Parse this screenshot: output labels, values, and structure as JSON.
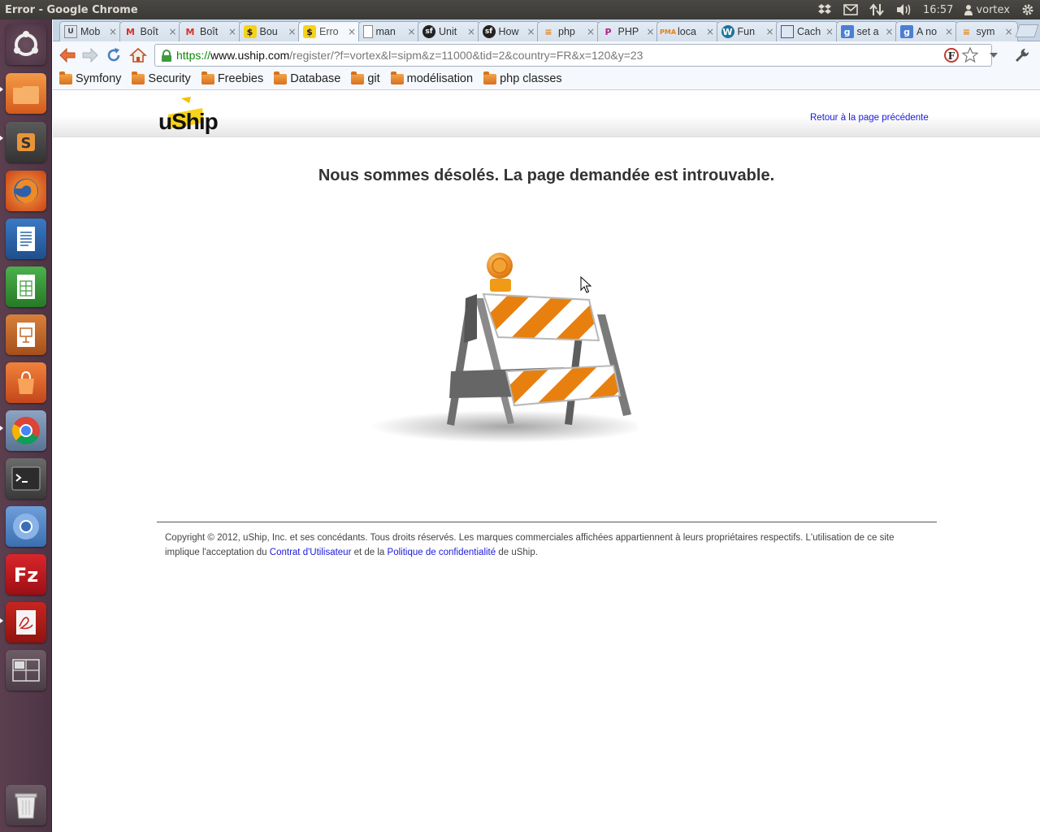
{
  "window": {
    "title": "Error - Google Chrome"
  },
  "panel": {
    "time": "16:57",
    "user": "vortex"
  },
  "launcher": {
    "items": [
      {
        "name": "ubuntu-dash-icon",
        "color": "#d45d2a"
      },
      {
        "name": "files-icon",
        "color": "#e07a2c"
      },
      {
        "name": "sublime-text-icon",
        "color": "#4a4a4a"
      },
      {
        "name": "firefox-icon",
        "color": "#e56a1d"
      },
      {
        "name": "writer-icon",
        "color": "#2a64a8"
      },
      {
        "name": "calc-icon",
        "color": "#3b9a3b"
      },
      {
        "name": "impress-icon",
        "color": "#c4682b"
      },
      {
        "name": "software-center-icon",
        "color": "#e0622a"
      },
      {
        "name": "chrome-icon",
        "color": "#4c8bd9"
      },
      {
        "name": "terminal-icon",
        "color": "#333333"
      },
      {
        "name": "chromium-icon",
        "color": "#5a8fd6"
      },
      {
        "name": "filezilla-icon",
        "color": "#c0161b"
      },
      {
        "name": "pdf-reader-icon",
        "color": "#d8d8d8"
      },
      {
        "name": "workspace-switcher-icon",
        "color": "#777777"
      },
      {
        "name": "trash-icon",
        "color": "#888888"
      }
    ]
  },
  "tabs": [
    {
      "label": "Mob",
      "icon": "U"
    },
    {
      "label": "Boît",
      "icon": "M"
    },
    {
      "label": "Boît",
      "icon": "M"
    },
    {
      "label": "Bou",
      "icon": "$"
    },
    {
      "label": "Erro",
      "icon": "$",
      "active": true
    },
    {
      "label": "man",
      "icon": "doc"
    },
    {
      "label": "Unit",
      "icon": "sf"
    },
    {
      "label": "How",
      "icon": "sf"
    },
    {
      "label": "php",
      "icon": "so"
    },
    {
      "label": "PHP",
      "icon": "ph"
    },
    {
      "label": "loca",
      "icon": "pma"
    },
    {
      "label": "Fun",
      "icon": "wp"
    },
    {
      "label": "Cach",
      "icon": "bk"
    },
    {
      "label": "set a",
      "icon": "g"
    },
    {
      "label": "A no",
      "icon": "g"
    },
    {
      "label": "sym",
      "icon": "so"
    }
  ],
  "tab_close_glyph": "×",
  "omnibox": {
    "scheme": "https://",
    "host": "www.uship.com",
    "path": "/register/?f=vortex&l=sipm&z=11000&tid=2&country=FR&x=120&y=23"
  },
  "bookmarks": [
    "Symfony",
    "Security",
    "Freebies",
    "Database",
    "git",
    "modélisation",
    "php classes"
  ],
  "page": {
    "logo_text": "uShip",
    "back_link": "Retour à la page précédente",
    "heading": "Nous sommes désolés. La page demandée est introuvable.",
    "footer": {
      "text_before": "Copyright © 2012, uShip, Inc. et ses concédants. Tous droits réservés. Les marques commerciales affichées appartiennent à leurs propriétaires respectifs. L'utilisation de ce site implique l'acceptation du ",
      "terms_link": "Contrat d'Utilisateur",
      "text_middle": " et de la ",
      "privacy_link": "Politique de confidentialité",
      "text_after": " de uShip."
    }
  },
  "colors": {
    "link": "#1a1adb",
    "url_scheme": "#0a8a0a",
    "launcher_bg": "#5b3f4f"
  }
}
